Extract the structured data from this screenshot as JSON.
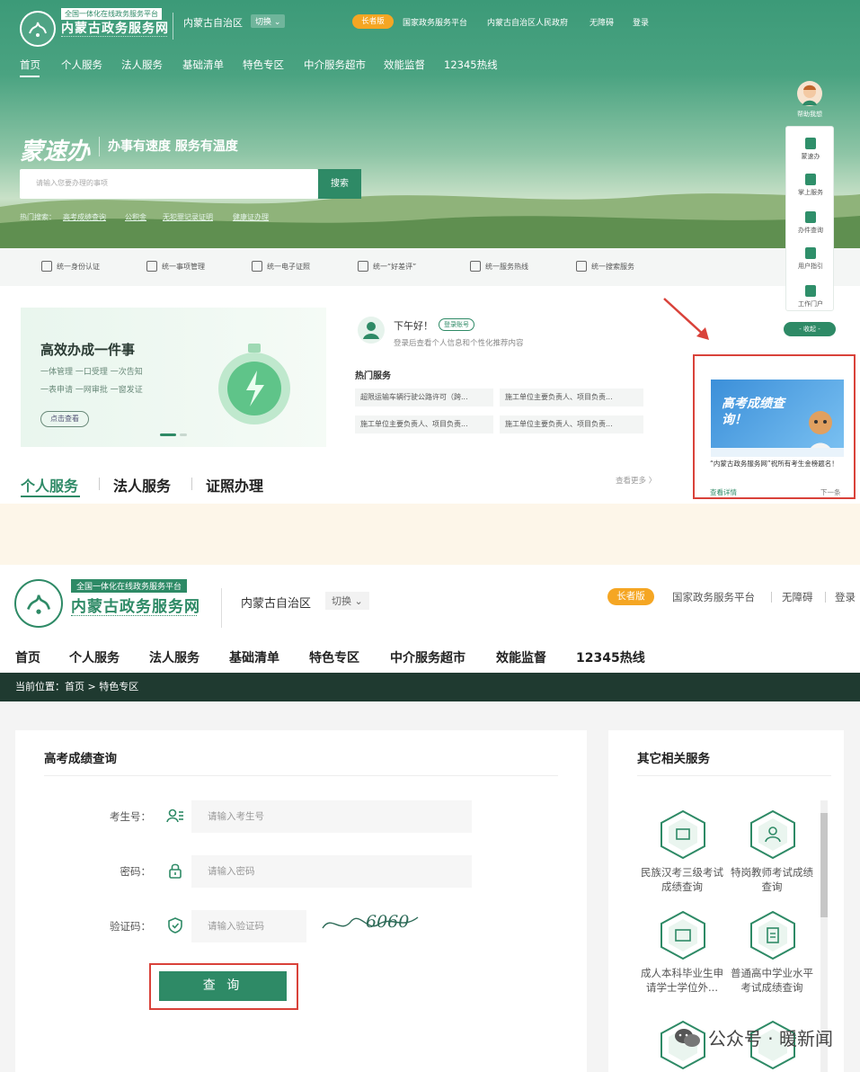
{
  "shot1": {
    "header": {
      "platform_tag": "全国一体化在线政务服务平台",
      "site_name": "内蒙古政务服务网",
      "region": "内蒙古自治区",
      "switch_label": "切换",
      "elder_mode": "长者版",
      "links": [
        "国家政务服务平台",
        "内蒙古自治区人民政府",
        "无障碍",
        "登录"
      ]
    },
    "nav": [
      "首页",
      "个人服务",
      "法人服务",
      "基础清单",
      "特色专区",
      "中介服务超市",
      "效能监督",
      "12345热线"
    ],
    "hero": {
      "brand_calligraphy": "蒙速办",
      "slogan": "办事有速度 服务有温度",
      "search_placeholder": "请输入您要办理的事项",
      "search_button": "搜索",
      "hot_label": "热门搜索：",
      "hot_keywords": [
        "高考成绩查询",
        "公积金",
        "无犯罪记录证明",
        "健康证办理"
      ]
    },
    "service_bar": [
      "统一身份认证",
      "统一事项管理",
      "统一电子证照",
      "统一“好差评”",
      "统一服务热线",
      "统一搜索服务"
    ],
    "banner": {
      "title": "高效办成一件事",
      "line1": "一体管理 一口受理 一次告知",
      "line2": "一表申请 一网审批 一窗发证",
      "button": "点击查看"
    },
    "greeting": {
      "hello": "下午好！",
      "login_badge": "登录账号",
      "sub": "登录后查看个人信息和个性化推荐内容"
    },
    "hot_services": {
      "title": "热门服务",
      "items": [
        "超限运输车辆行驶公路许可（跨...",
        "施工单位主要负责人、项目负责...",
        "施工单位主要负责人、项目负责...",
        "施工单位主要负责人、项目负责..."
      ]
    },
    "tabs": [
      "个人服务",
      "法人服务",
      "证照办理"
    ],
    "more": "查看更多 〉",
    "side_panel": {
      "assistant": "帮助我想",
      "items": [
        "蒙速办",
        "掌上服务",
        "办件查询",
        "用户指引",
        "工作门户"
      ],
      "collapse": "- 收起 -"
    },
    "popup": {
      "image_text": "高考成绩查询！",
      "caption": "“内蒙古政务服务网”祝所有考生金榜题名！",
      "detail": "查看详情",
      "next": "下一条"
    }
  },
  "shot2": {
    "header": {
      "platform_tag": "全国一体化在线政务服务平台",
      "site_name": "内蒙古政务服务网",
      "region": "内蒙古自治区",
      "switch_label": "切换",
      "elder_mode": "长者版",
      "links": [
        "国家政务服务平台",
        "无障碍",
        "登录"
      ]
    },
    "nav": [
      "首页",
      "个人服务",
      "法人服务",
      "基础清单",
      "特色专区",
      "中介服务超市",
      "效能监督",
      "12345热线"
    ],
    "breadcrumb": "当前位置：首页 > 特色专区",
    "form": {
      "title": "高考成绩查询",
      "fields": [
        {
          "label": "考生号：",
          "placeholder": "请输入考生号"
        },
        {
          "label": "密码：",
          "placeholder": "请输入密码"
        },
        {
          "label": "验证码：",
          "placeholder": "请输入验证码"
        }
      ],
      "captcha": "6060",
      "submit": "查 询"
    },
    "related": {
      "title": "其它相关服务",
      "items": [
        "民族汉考三级考试成绩查询",
        "特岗教师考试成绩查询",
        "成人本科毕业生申请学士学位外...",
        "普通高中学业水平考试成绩查询"
      ]
    },
    "watermark": "公众号 · 暖新闻"
  },
  "colors": {
    "brand_green": "#2e8a66",
    "highlight_red": "#d9423a",
    "elder_orange": "#f5a623",
    "dark_bar": "#1f3a30"
  }
}
